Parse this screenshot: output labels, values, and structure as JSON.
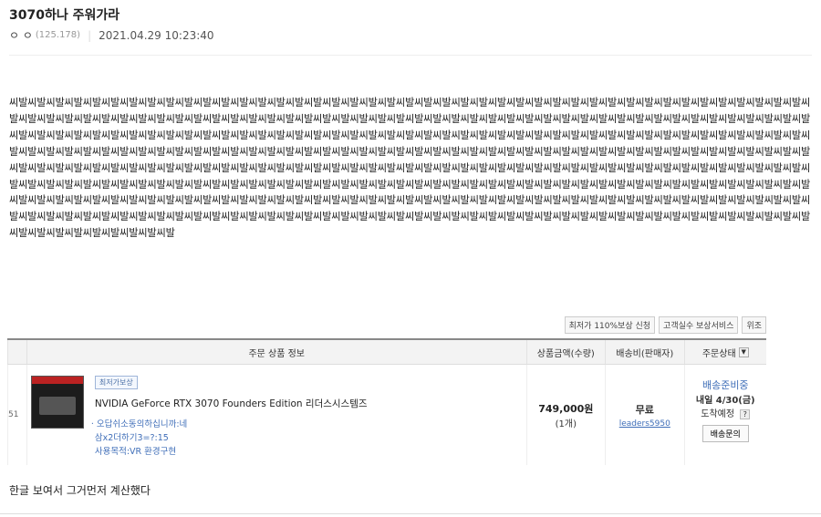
{
  "post": {
    "title": "3070하나 주워가라",
    "author_nick": "ㅇ ㅇ",
    "author_ip": "(125.178)",
    "date": "2021.04.29 10:23:40",
    "body_text": "씨발씨발씨발씨발씨발씨발씨발씨발씨발씨발씨발씨발씨발씨발씨발씨발씨발씨발씨발씨발씨발씨발씨발씨발씨발씨발씨발씨발씨발씨발씨발씨발씨발씨발씨발씨발씨발씨발씨발씨발씨발씨발씨발씨발씨발씨발씨발씨발씨발씨발씨발씨발씨발씨발씨발씨발씨발씨발씨발씨발씨발씨발씨발씨발씨발씨발씨발씨발씨발씨발씨발씨발씨발씨발씨발씨발씨발씨발씨발씨발씨발씨발씨발씨발씨발씨발씨발씨발씨발씨발씨발씨발씨발씨발씨발씨발씨발씨발씨발씨발씨발씨발씨발씨발씨발씨발씨발씨발씨발씨발씨발씨발씨발씨발씨발씨발씨발씨발씨발씨발씨발씨발씨발씨발씨발씨발씨발씨발씨발씨발씨발씨발씨발씨발씨발씨발씨발씨발씨발씨발씨발씨발씨발씨발씨발씨발씨발씨발씨발씨발씨발씨발씨발씨발씨발씨발씨발씨발씨발씨발씨발씨발씨발씨발씨발씨발씨발씨발씨발씨발씨발씨발씨발씨발씨발씨발씨발씨발씨발씨발씨발씨발씨발씨발씨발씨발씨발씨발씨발씨발씨발씨발씨발씨발씨발씨발씨발씨발씨발씨발씨발씨발씨발씨발씨발씨발씨발씨발씨발씨발씨발씨발씨발씨발씨발씨발씨발씨발씨발씨발씨발씨발씨발씨발씨발씨발씨발씨발씨발씨발씨발씨발씨발씨발씨발씨발씨발씨발씨발씨발씨발씨발씨발씨발씨발씨발씨발씨발씨발씨발씨발씨발씨발씨발씨발씨발씨발씨발씨발씨발씨발씨발씨발씨발씨발씨발씨발씨발씨발씨발씨발씨발씨발씨발씨발씨발씨발씨발씨발씨발씨발씨발씨발씨발씨발씨발씨발씨발씨발씨발씨발씨발씨발씨발씨발씨발씨발씨발씨발씨발씨발씨발씨발씨발씨발씨발씨발씨발씨발씨발씨발씨발씨발씨발씨발씨발씨발씨발씨발씨발씨발씨발씨발씨발씨발씨발씨발씨발씨발씨발씨발씨발씨발씨발씨발씨발씨발씨발씨발씨발씨발씨발씨발씨발씨발씨발씨발씨발씨발씨발씨발씨발씨발씨발씨발씨발씨발",
    "caption": "한글 보여서 그거먼저 계산했다"
  },
  "screenshot": {
    "tags": [
      "최저가 110%보상 신청",
      "고객실수 보상서비스",
      "위조"
    ],
    "headers": {
      "item_info": "주문 상품 정보",
      "price_qty": "상품금액(수량)",
      "shipping": "배송비(판매자)",
      "status": "주문상태"
    },
    "row": {
      "row_num": "51",
      "badge": "최저가보상",
      "product_name": "NVIDIA GeForce RTX 3070 Founders Edition 리더스시스템즈",
      "option1": "· 오답쉬소동의하십니까:네",
      "option2": "삼x2더하기3=?:15",
      "option3": "사용목적:VR 환경구현",
      "price": "749,000원",
      "qty": "(1개)",
      "shipping_fee": "무료",
      "seller": "leaders5950",
      "status_label": "배송준비중",
      "eta": "내일 4/30(금)",
      "eta_note": "도착예정",
      "inquiry_button": "배송문의"
    }
  }
}
